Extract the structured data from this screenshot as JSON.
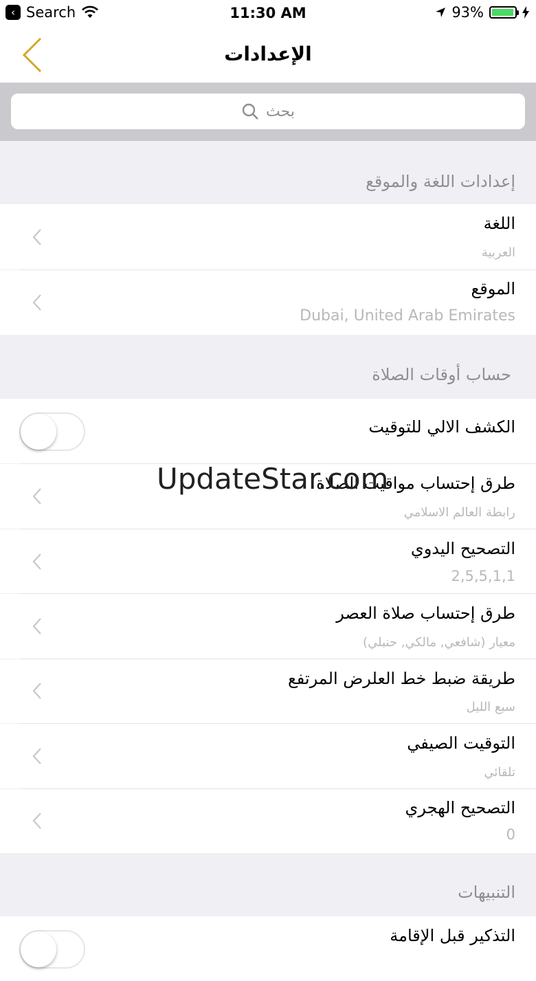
{
  "status_bar": {
    "back_app": "Search",
    "time": "11:30 AM",
    "battery": "93%",
    "battery_level": 0.93
  },
  "nav": {
    "title": "الإعدادات"
  },
  "search": {
    "placeholder": "بحث"
  },
  "sections": {
    "language_location": {
      "header": "إعدادات اللغة والموقع",
      "language": {
        "title": "اللغة",
        "value": "العربية"
      },
      "location": {
        "title": "الموقع",
        "value": "Dubai, United Arab Emirates"
      }
    },
    "prayer_times": {
      "header": "حساب أوقات الصلاة",
      "auto_detect": {
        "title": "الكشف الالي للتوقيت",
        "on": false
      },
      "calc_method": {
        "title": "طرق إحتساب مواقيت الصلاة",
        "value": "رابطة العالم الاسلامي"
      },
      "manual_correction": {
        "title": "التصحيح اليدوي",
        "value": "2,5,5,1,1"
      },
      "asr_method": {
        "title": "طرق إحتساب صلاة العصر",
        "value": "معيار (شافعي, مالكي, حنبلي)"
      },
      "high_latitude": {
        "title": "طريقة ضبط خط العلرض المرتفع",
        "value": "سبع الليل"
      },
      "daylight_saving": {
        "title": "التوقيت الصيفي",
        "value": "تلقائي"
      },
      "hijri_correction": {
        "title": "التصحيح الهجري",
        "value": "0"
      }
    },
    "alerts": {
      "header": "التنبيهات",
      "iqama_reminder": {
        "title": "التذكير قبل الإقامة",
        "on": false
      }
    }
  },
  "watermark": "UpdateStar.com",
  "colors": {
    "accent": "#d4a72c",
    "toggle_on": "#4cd964"
  }
}
